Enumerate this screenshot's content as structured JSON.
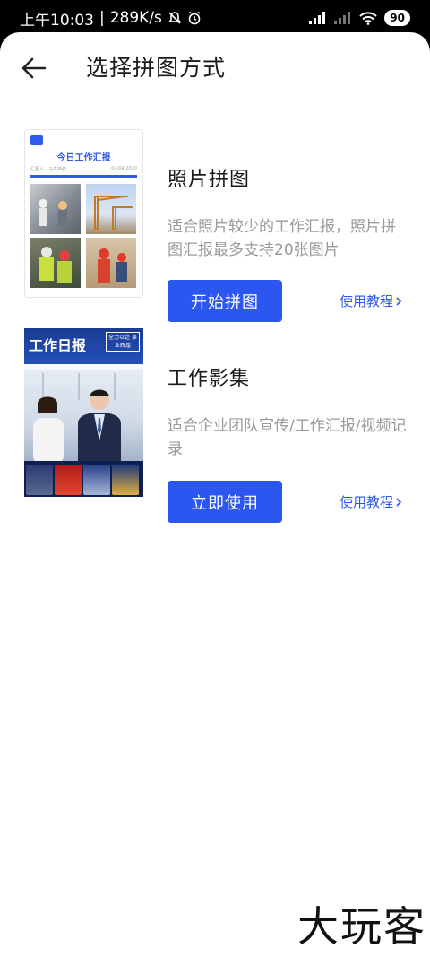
{
  "status_bar": {
    "time": "上午10:03",
    "speed": "289K/s",
    "battery": "90"
  },
  "header": {
    "title": "选择拼图方式"
  },
  "cards": [
    {
      "title": "照片拼图",
      "description": "适合照片较少的工作汇报，照片拼图汇报最多支持20张图片",
      "button": "开始拼图",
      "link": "使用教程",
      "thumb": {
        "title": "今日工作汇报",
        "reporter": "汇报人：马先锋航",
        "date": "04/04 2020"
      }
    },
    {
      "title": "工作影集",
      "description": "适合企业团队宣传/工作汇报/视频记录",
      "button": "立即使用",
      "link": "使用教程",
      "thumb": {
        "title": "工作日报",
        "tag": "全力以赴 事业辉煌"
      }
    }
  ],
  "watermark": "大玩客",
  "colors": {
    "primary": "#2c56f0",
    "text": "#1a1a1a",
    "secondary_text": "#9a9a9a"
  }
}
